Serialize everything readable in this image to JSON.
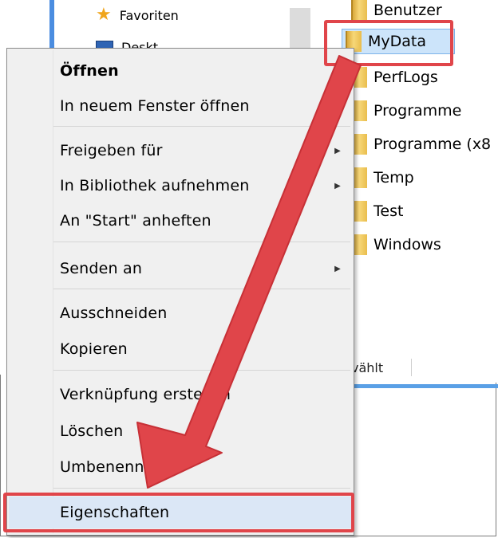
{
  "nav": {
    "favorites_label": "Favoriten",
    "desktop_label": "Deskt"
  },
  "folders": [
    {
      "name": "Benutzer"
    },
    {
      "name": "MyData",
      "selected": true
    },
    {
      "name": "PerfLogs"
    },
    {
      "name": "Programme"
    },
    {
      "name": "Programme (x8"
    },
    {
      "name": "Temp"
    },
    {
      "name": "Test"
    },
    {
      "name": "Windows"
    }
  ],
  "status_bar": {
    "text": "vählt"
  },
  "context_menu": {
    "open": "Öffnen",
    "open_new_window": "In neuem Fenster öffnen",
    "share_with": "Freigeben für",
    "include_in_library": "In Bibliothek aufnehmen",
    "pin_to_start": "An \"Start\" anheften",
    "send_to": "Senden an",
    "cut": "Ausschneiden",
    "copy": "Kopieren",
    "create_shortcut": "Verknüpfung erstellen",
    "delete": "Löschen",
    "rename": "Umbenennen",
    "properties": "Eigenschaften"
  },
  "colors": {
    "annotation_red": "#e0454a",
    "selection_blue": "#cce4fa",
    "menu_background": "#f0f0f0"
  }
}
